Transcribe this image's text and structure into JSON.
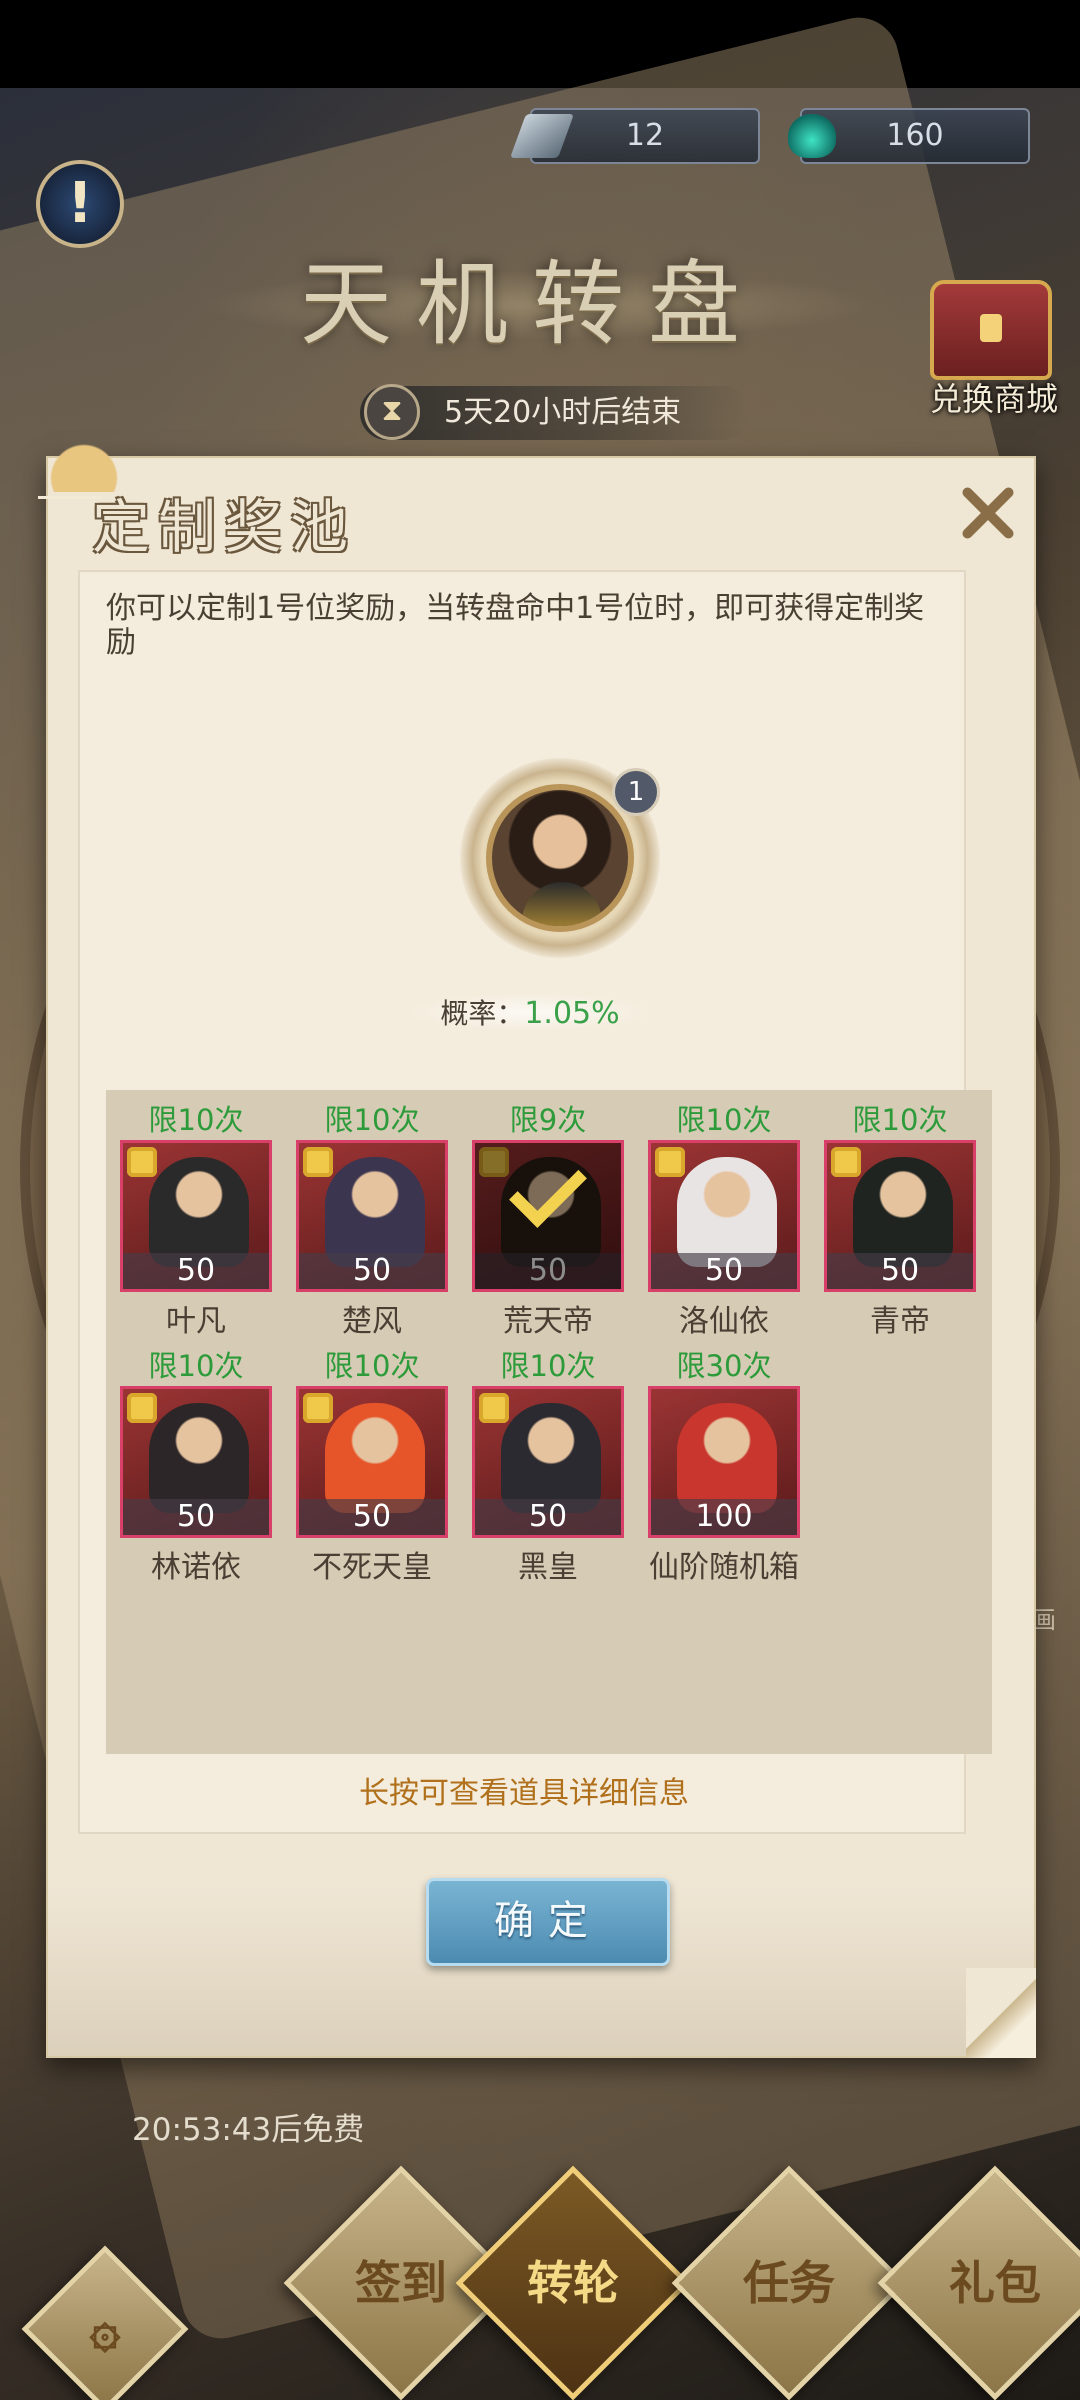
{
  "header": {
    "currency": [
      {
        "icon": "ticket-icon",
        "value": "12"
      },
      {
        "icon": "jade-flame-icon",
        "value": "160"
      }
    ],
    "title": "天机转盘",
    "shop_label": "兑换商城",
    "timer": "5天20小时后结束"
  },
  "panel": {
    "title": "定制奖池",
    "description": "你可以定制1号位奖励，当转盘命中1号位时，即可获得定制奖励",
    "slot_number": "1",
    "probability_label": "概率：",
    "probability_value": "1.05%",
    "items": [
      {
        "limit": "限10次",
        "qty": "50",
        "name": "叶凡",
        "owned": false,
        "color": "#2a2a2a"
      },
      {
        "limit": "限10次",
        "qty": "50",
        "name": "楚风",
        "owned": false,
        "color": "#3b3550"
      },
      {
        "limit": "限9次",
        "qty": "50",
        "name": "荒天帝",
        "owned": true,
        "color": "#2a1e15"
      },
      {
        "limit": "限10次",
        "qty": "50",
        "name": "洛仙依",
        "owned": false,
        "color": "#e9e4e4"
      },
      {
        "limit": "限10次",
        "qty": "50",
        "name": "青帝",
        "owned": false,
        "color": "#1f2420"
      },
      {
        "limit": "限10次",
        "qty": "50",
        "name": "林诺依",
        "owned": false,
        "color": "#2d2628"
      },
      {
        "limit": "限10次",
        "qty": "50",
        "name": "不死天皇",
        "owned": false,
        "color": "#e6552a"
      },
      {
        "limit": "限10次",
        "qty": "50",
        "name": "黑皇",
        "owned": false,
        "color": "#2b2a30"
      },
      {
        "limit": "限30次",
        "qty": "100",
        "name": "仙阶随机箱",
        "owned": false,
        "color": "#c8362e"
      }
    ],
    "hint": "长按可查看道具详细信息",
    "confirm_label": "确定"
  },
  "background": {
    "free_timer": "20:53:43后免费"
  },
  "nav": [
    {
      "label": "签到"
    },
    {
      "label": "转轮"
    },
    {
      "label": "任务"
    },
    {
      "label": "礼包"
    }
  ]
}
